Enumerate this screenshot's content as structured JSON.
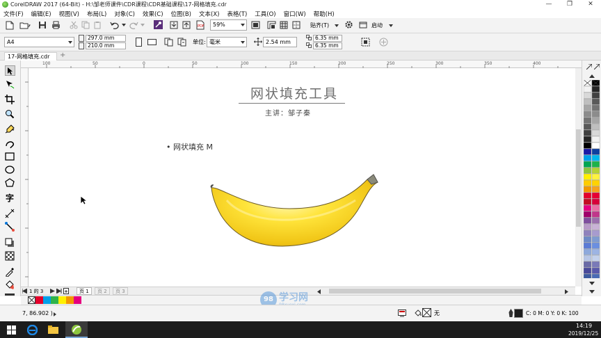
{
  "window": {
    "title": "CorelDRAW 2017 (64-Bit) - H:\\邹老师课件\\CDR课程\\CDR基础课程\\17-网格填充.cdr",
    "minimize": "—",
    "restore": "❐",
    "close": "✕"
  },
  "menu": [
    "文件(F)",
    "编辑(E)",
    "视图(V)",
    "布局(L)",
    "对象(C)",
    "效果(C)",
    "位图(B)",
    "文本(X)",
    "表格(T)",
    "工具(O)",
    "窗口(W)",
    "帮助(H)"
  ],
  "toolbar1": {
    "zoom": "59%",
    "snap_label": "贴齐(T)",
    "launch_label": "启动"
  },
  "toolbar2": {
    "page_size": "A4",
    "width": "297.0 mm",
    "height": "210.0 mm",
    "unit_label": "单位:",
    "unit_value": "毫米",
    "nudge": "2.54 mm",
    "dup_x": "6.35 mm",
    "dup_y": "6.35 mm"
  },
  "doc_tab": {
    "name": "17-网格填充.cdr",
    "add": "+"
  },
  "ruler_top_labels": [
    "100",
    "50",
    "0",
    "50",
    "100",
    "150",
    "200",
    "250",
    "300",
    "350",
    "400"
  ],
  "ruler_left_labels": [
    "100",
    "150",
    "200",
    "250"
  ],
  "slide": {
    "title": "网状填充工具",
    "subtitle": "主讲：邹子秦",
    "bullet": "网状填充 M"
  },
  "pagebar": {
    "page_count": "1 的 3",
    "pages": [
      "页 1",
      "页 2",
      "页 3"
    ]
  },
  "statusbar": {
    "coords": "7, 86.902 )",
    "fill_label": "无",
    "color_readout": "C: 0 M: 0 Y: 0 K: 100"
  },
  "watermark": {
    "brand": "学习网",
    "sub": "98xuexi.com"
  },
  "taskbar": {
    "time": "14:19",
    "date": "2019/12/25"
  },
  "colors": {
    "accent_purple": "#5a2d7a",
    "banana_yellow": "#f5d21c",
    "banana_light": "#fff3a0"
  }
}
